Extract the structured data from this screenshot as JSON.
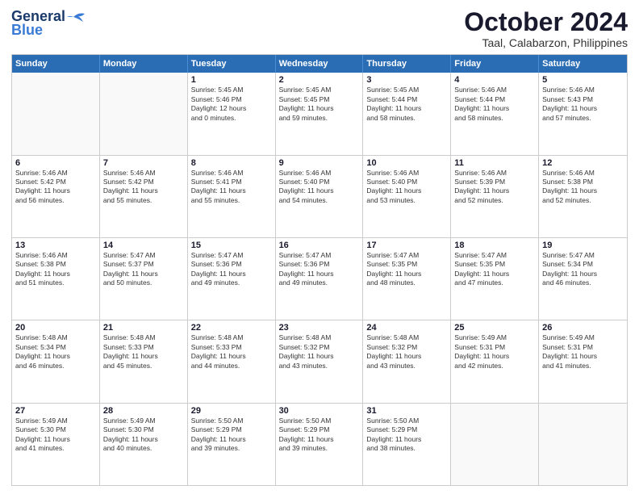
{
  "logo": {
    "line1": "General",
    "line2": "Blue"
  },
  "title": "October 2024",
  "subtitle": "Taal, Calabarzon, Philippines",
  "header_days": [
    "Sunday",
    "Monday",
    "Tuesday",
    "Wednesday",
    "Thursday",
    "Friday",
    "Saturday"
  ],
  "weeks": [
    [
      {
        "day": "",
        "text": ""
      },
      {
        "day": "",
        "text": ""
      },
      {
        "day": "1",
        "text": "Sunrise: 5:45 AM\nSunset: 5:46 PM\nDaylight: 12 hours\nand 0 minutes."
      },
      {
        "day": "2",
        "text": "Sunrise: 5:45 AM\nSunset: 5:45 PM\nDaylight: 11 hours\nand 59 minutes."
      },
      {
        "day": "3",
        "text": "Sunrise: 5:45 AM\nSunset: 5:44 PM\nDaylight: 11 hours\nand 58 minutes."
      },
      {
        "day": "4",
        "text": "Sunrise: 5:46 AM\nSunset: 5:44 PM\nDaylight: 11 hours\nand 58 minutes."
      },
      {
        "day": "5",
        "text": "Sunrise: 5:46 AM\nSunset: 5:43 PM\nDaylight: 11 hours\nand 57 minutes."
      }
    ],
    [
      {
        "day": "6",
        "text": "Sunrise: 5:46 AM\nSunset: 5:42 PM\nDaylight: 11 hours\nand 56 minutes."
      },
      {
        "day": "7",
        "text": "Sunrise: 5:46 AM\nSunset: 5:42 PM\nDaylight: 11 hours\nand 55 minutes."
      },
      {
        "day": "8",
        "text": "Sunrise: 5:46 AM\nSunset: 5:41 PM\nDaylight: 11 hours\nand 55 minutes."
      },
      {
        "day": "9",
        "text": "Sunrise: 5:46 AM\nSunset: 5:40 PM\nDaylight: 11 hours\nand 54 minutes."
      },
      {
        "day": "10",
        "text": "Sunrise: 5:46 AM\nSunset: 5:40 PM\nDaylight: 11 hours\nand 53 minutes."
      },
      {
        "day": "11",
        "text": "Sunrise: 5:46 AM\nSunset: 5:39 PM\nDaylight: 11 hours\nand 52 minutes."
      },
      {
        "day": "12",
        "text": "Sunrise: 5:46 AM\nSunset: 5:38 PM\nDaylight: 11 hours\nand 52 minutes."
      }
    ],
    [
      {
        "day": "13",
        "text": "Sunrise: 5:46 AM\nSunset: 5:38 PM\nDaylight: 11 hours\nand 51 minutes."
      },
      {
        "day": "14",
        "text": "Sunrise: 5:47 AM\nSunset: 5:37 PM\nDaylight: 11 hours\nand 50 minutes."
      },
      {
        "day": "15",
        "text": "Sunrise: 5:47 AM\nSunset: 5:36 PM\nDaylight: 11 hours\nand 49 minutes."
      },
      {
        "day": "16",
        "text": "Sunrise: 5:47 AM\nSunset: 5:36 PM\nDaylight: 11 hours\nand 49 minutes."
      },
      {
        "day": "17",
        "text": "Sunrise: 5:47 AM\nSunset: 5:35 PM\nDaylight: 11 hours\nand 48 minutes."
      },
      {
        "day": "18",
        "text": "Sunrise: 5:47 AM\nSunset: 5:35 PM\nDaylight: 11 hours\nand 47 minutes."
      },
      {
        "day": "19",
        "text": "Sunrise: 5:47 AM\nSunset: 5:34 PM\nDaylight: 11 hours\nand 46 minutes."
      }
    ],
    [
      {
        "day": "20",
        "text": "Sunrise: 5:48 AM\nSunset: 5:34 PM\nDaylight: 11 hours\nand 46 minutes."
      },
      {
        "day": "21",
        "text": "Sunrise: 5:48 AM\nSunset: 5:33 PM\nDaylight: 11 hours\nand 45 minutes."
      },
      {
        "day": "22",
        "text": "Sunrise: 5:48 AM\nSunset: 5:33 PM\nDaylight: 11 hours\nand 44 minutes."
      },
      {
        "day": "23",
        "text": "Sunrise: 5:48 AM\nSunset: 5:32 PM\nDaylight: 11 hours\nand 43 minutes."
      },
      {
        "day": "24",
        "text": "Sunrise: 5:48 AM\nSunset: 5:32 PM\nDaylight: 11 hours\nand 43 minutes."
      },
      {
        "day": "25",
        "text": "Sunrise: 5:49 AM\nSunset: 5:31 PM\nDaylight: 11 hours\nand 42 minutes."
      },
      {
        "day": "26",
        "text": "Sunrise: 5:49 AM\nSunset: 5:31 PM\nDaylight: 11 hours\nand 41 minutes."
      }
    ],
    [
      {
        "day": "27",
        "text": "Sunrise: 5:49 AM\nSunset: 5:30 PM\nDaylight: 11 hours\nand 41 minutes."
      },
      {
        "day": "28",
        "text": "Sunrise: 5:49 AM\nSunset: 5:30 PM\nDaylight: 11 hours\nand 40 minutes."
      },
      {
        "day": "29",
        "text": "Sunrise: 5:50 AM\nSunset: 5:29 PM\nDaylight: 11 hours\nand 39 minutes."
      },
      {
        "day": "30",
        "text": "Sunrise: 5:50 AM\nSunset: 5:29 PM\nDaylight: 11 hours\nand 39 minutes."
      },
      {
        "day": "31",
        "text": "Sunrise: 5:50 AM\nSunset: 5:29 PM\nDaylight: 11 hours\nand 38 minutes."
      },
      {
        "day": "",
        "text": ""
      },
      {
        "day": "",
        "text": ""
      }
    ]
  ]
}
